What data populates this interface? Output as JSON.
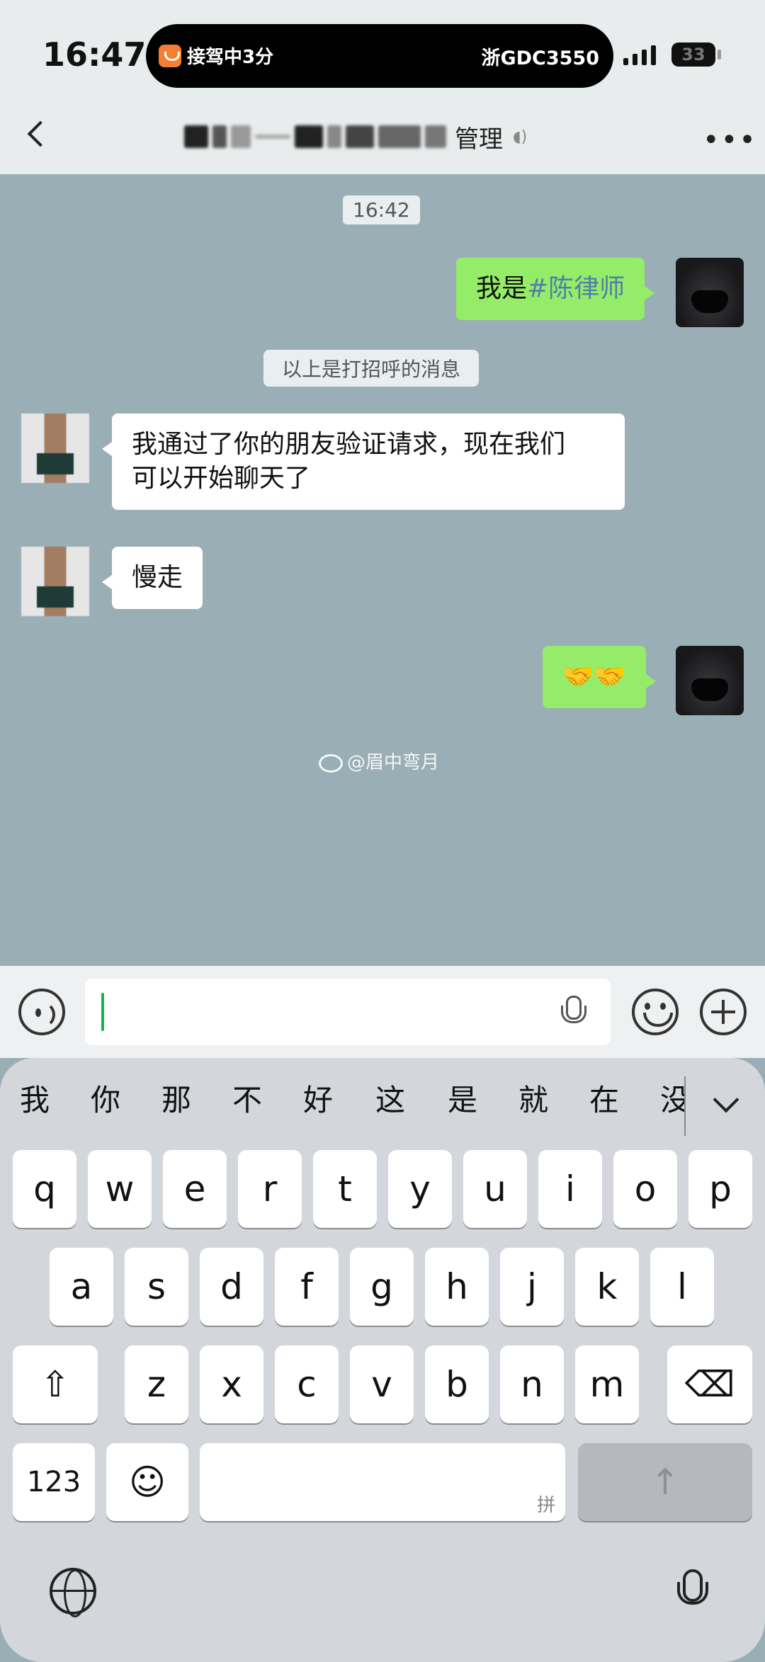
{
  "status_bar": {
    "time": "16:47",
    "ride_status": "接驾中3分",
    "plate": "浙GDC3550",
    "battery": "33"
  },
  "header": {
    "title_visible_suffix": "管理",
    "title_redacted": true
  },
  "chat": {
    "timestamp": "16:42",
    "notice": "以上是打招呼的消息",
    "messages": [
      {
        "side": "right",
        "prefix": "我是",
        "hashtag": "#陈律师"
      },
      {
        "side": "left",
        "text_line1": "我通过了你的朋友验证请求，现在我们",
        "text_line2": "可以开始聊天了"
      },
      {
        "side": "left",
        "text": "慢走"
      },
      {
        "side": "right",
        "text": "🤝🤝"
      }
    ],
    "watermark": "@眉中弯月"
  },
  "input": {
    "placeholder": ""
  },
  "keyboard": {
    "candidates": [
      "我",
      "你",
      "那",
      "不",
      "好",
      "这",
      "是",
      "就",
      "在",
      "没"
    ],
    "row1": [
      "q",
      "w",
      "e",
      "r",
      "t",
      "y",
      "u",
      "i",
      "o",
      "p"
    ],
    "row2": [
      "a",
      "s",
      "d",
      "f",
      "g",
      "h",
      "j",
      "k",
      "l"
    ],
    "row3": [
      "z",
      "x",
      "c",
      "v",
      "b",
      "n",
      "m"
    ],
    "numbers_key": "123",
    "space_hint": "拼",
    "emoji_key": "☺",
    "shift_key": "⇧",
    "delete_key": "⌫",
    "send_key": "↑"
  },
  "colors": {
    "chat_bg": "#9aafb5",
    "my_bubble": "#95ec69",
    "their_bubble": "#ffffff",
    "hashtag": "#4f7fa8",
    "caret": "#18b34a"
  }
}
